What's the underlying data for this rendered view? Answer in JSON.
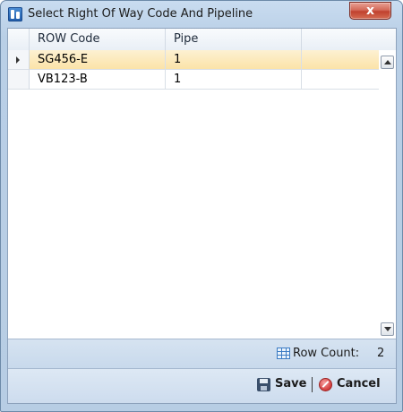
{
  "window": {
    "title": "Select Right Of Way Code And Pipeline",
    "close_glyph": "x"
  },
  "grid": {
    "columns": [
      "ROW Code",
      "Pipe",
      ""
    ],
    "rows": [
      {
        "row_code": "SG456-E",
        "pipe": "1",
        "selected": true
      },
      {
        "row_code": "VB123-B",
        "pipe": "1",
        "selected": false
      }
    ]
  },
  "status": {
    "row_count_label": "Row Count:",
    "row_count_value": "2"
  },
  "actions": {
    "save_label": "Save",
    "cancel_label": "Cancel"
  },
  "icons": {
    "app": "app-icon",
    "table": "table-icon",
    "save": "save-disk-icon",
    "cancel": "cancel-icon"
  },
  "colors": {
    "selected_row": "#fbe3a8",
    "close_button": "#c0412e",
    "status_bar": "#c8d9ec"
  }
}
